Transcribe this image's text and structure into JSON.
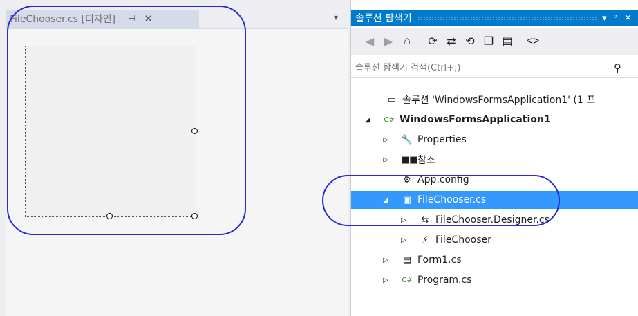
{
  "designer": {
    "tab_label": "FileChooser.cs [디자인]",
    "pin_glyph": "⊣",
    "close_glyph": "✕",
    "overflow_glyph": "▾"
  },
  "explorer": {
    "title": "솔루션 탐색기",
    "header_buttons": {
      "dropdown": "▾",
      "pin": "ᵖ",
      "close": "✕"
    },
    "toolbar": [
      "◀",
      "▶",
      "⌂",
      "⟳",
      "⇄",
      "⟲",
      "❐",
      "▤",
      "<>"
    ],
    "search_placeholder": "솔루션 탐색기 검색(Ctrl+;)",
    "search_icon": "⚲",
    "tree": [
      {
        "label": "솔루션 'WindowsFormsApplication1' (1 프",
        "icon": "▭",
        "expander": "",
        "indent": 0
      },
      {
        "label": "WindowsFormsApplication1",
        "icon": "C#",
        "expander": "◢",
        "indent": 1,
        "bold": true
      },
      {
        "label": "Properties",
        "icon": "🔧",
        "expander": "▷",
        "indent": 2
      },
      {
        "label": "참조",
        "icon": "■■",
        "expander": "▷",
        "indent": 2
      },
      {
        "label": "App.config",
        "icon": "⚙",
        "expander": "",
        "indent": 2
      },
      {
        "label": "FileChooser.cs",
        "icon": "▣",
        "expander": "◢",
        "indent": 2,
        "selected": true
      },
      {
        "label": "FileChooser.Designer.cs",
        "icon": "⇆",
        "expander": "▷",
        "indent": 3
      },
      {
        "label": "FileChooser",
        "icon": "⚡",
        "expander": "▷",
        "indent": 3
      },
      {
        "label": "Form1.cs",
        "icon": "▤",
        "expander": "▷",
        "indent": 2
      },
      {
        "label": "Program.cs",
        "icon": "C#",
        "expander": "▷",
        "indent": 2
      }
    ]
  }
}
